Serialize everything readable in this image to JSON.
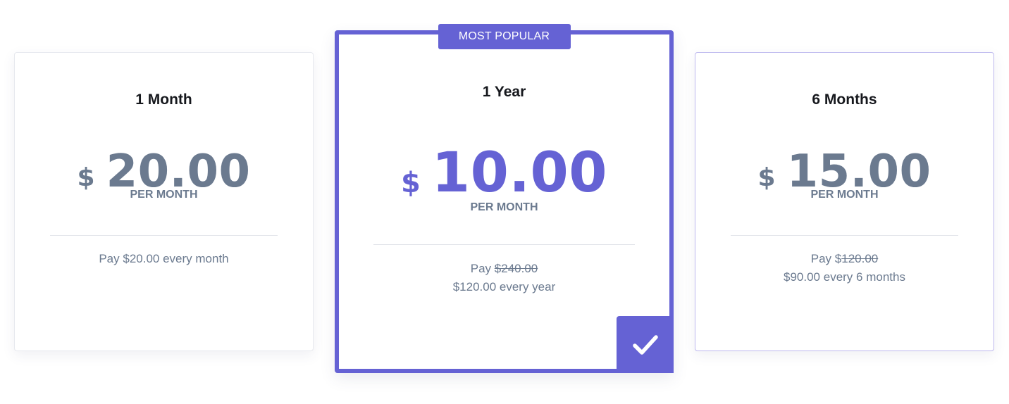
{
  "plans": [
    {
      "title": "1 Month",
      "currency": "$",
      "amount": "20.00",
      "period": "PER MONTH",
      "pay_prefix": "Pay ",
      "pay_amount": "$20.00 every month"
    },
    {
      "badge": "MOST POPULAR",
      "title": "1 Year",
      "currency": "$",
      "amount": "10.00",
      "period": "PER MONTH",
      "pay_prefix": "Pay ",
      "original_price": "$240.00",
      "pay_line2": "$120.00 every year",
      "selected": true,
      "check_icon": "checkmark-icon"
    },
    {
      "title": "6 Months",
      "currency": "$",
      "amount": "15.00",
      "period": "PER MONTH",
      "pay_prefix": "Pay $",
      "original_price": "120.00",
      "pay_line2": "$90.00 every 6 months"
    }
  ],
  "colors": {
    "accent": "#6562d4",
    "text_muted": "#6b7a8f",
    "title": "#16181d",
    "border": "#e6e8ee"
  }
}
